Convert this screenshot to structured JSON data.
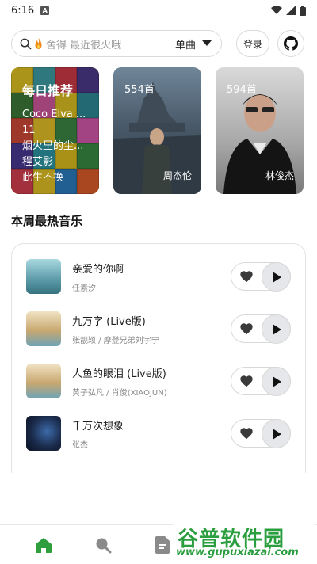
{
  "status_bar": {
    "time": "6:16",
    "badge": "A"
  },
  "search": {
    "placeholder": "舍得 最近很火哦",
    "type_selected": "单曲"
  },
  "header": {
    "login_label": "登录"
  },
  "cards": {
    "daily": {
      "title": "每日推荐",
      "items": [
        "Coco Elva ...",
        "11",
        "烟火里的尘...",
        "程艾影",
        "此生不换"
      ]
    },
    "artist1": {
      "count": "554首",
      "name": "周杰伦"
    },
    "artist2": {
      "count": "594首",
      "name": "林俊杰"
    }
  },
  "section": {
    "title": "本周最热音乐"
  },
  "songs": [
    {
      "title": "亲爱的你啊",
      "artist": "任素汐",
      "cover_color": "#5b9aa8"
    },
    {
      "title": "九万字 (Live版)",
      "artist": "张靓颖 / 摩登兄弟刘宇宁",
      "cover_color": "#c9a870"
    },
    {
      "title": "人鱼的眼泪 (Live版)",
      "artist": "黄子弘凡 / 肖俊(XIAOJUN)",
      "cover_color": "#c9a870"
    },
    {
      "title": "千万次想象",
      "artist": "张杰",
      "cover_color": "#1a2a4a"
    }
  ],
  "watermark": {
    "brand": "谷普软件园",
    "url": "www.gupuxiazai.com"
  },
  "colors": {
    "accent": "#2e9e3e",
    "play_bg": "#e6e7ea"
  }
}
